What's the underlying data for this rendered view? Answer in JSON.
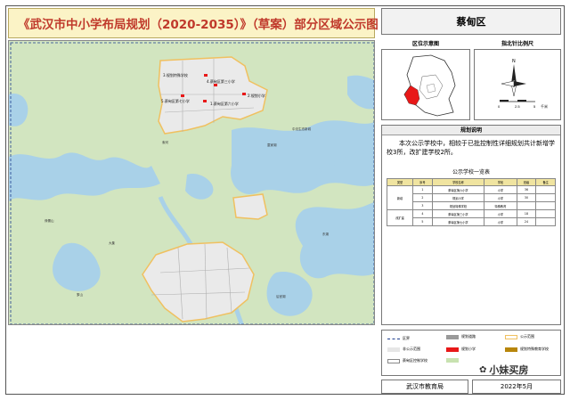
{
  "title": "《武汉市中小学布局规划（2020-2035）》（草案）部分区域公示图",
  "district": "蔡甸区",
  "location_header": "区位示意图",
  "north_header": "指北针比例尺",
  "scale": {
    "ticks": [
      "0",
      "2.5",
      "5"
    ],
    "unit": "千米",
    "north": "N"
  },
  "description": {
    "header": "规划说明",
    "text": "本次公示学校中，相较于已批控制性详细规划共计新增学校3所，改扩建学校2所。"
  },
  "table": {
    "title": "公示学校一览表",
    "headers": [
      "类型",
      "序号",
      "学校名称",
      "学段",
      "班级",
      "备注"
    ],
    "rows": [
      {
        "type": "新增",
        "no": "1",
        "name": "蔡甸区第六小学",
        "level": "小学",
        "classes": "36",
        "note": ""
      },
      {
        "type": "",
        "no": "2",
        "name": "规划小学",
        "level": "小学",
        "classes": "30",
        "note": ""
      },
      {
        "type": "",
        "no": "3",
        "name": "规划特殊学校",
        "level": "特殊教育",
        "classes": "",
        "note": ""
      },
      {
        "type": "改扩建",
        "no": "4",
        "name": "蔡甸区第三小学",
        "level": "小学",
        "classes": "18",
        "note": ""
      },
      {
        "type": "",
        "no": "5",
        "name": "蔡甸区第七小学",
        "level": "小学",
        "classes": "24",
        "note": ""
      }
    ]
  },
  "legend": [
    {
      "label": "区界",
      "color": "#1f3f8f",
      "style": "dash"
    },
    {
      "label": "规划道路",
      "color": "#9a9a9a",
      "style": "fill"
    },
    {
      "label": "公示范围",
      "color": "#f0c060",
      "style": "outline"
    },
    {
      "label": "非公示范围",
      "color": "#e6e6e6",
      "style": "fill"
    },
    {
      "label": "规划小学",
      "color": "#e81818",
      "style": "fill"
    },
    {
      "label": "规划特殊教育学校",
      "color": "#b8860b",
      "style": "fill"
    },
    {
      "label": "蔡甸区控制学校",
      "color": "#ffffff",
      "style": "outline"
    },
    {
      "label": "",
      "color": "#c8e2b0",
      "style": "fill"
    },
    {
      "label": "",
      "color": "#a8d0e8",
      "style": "fill"
    }
  ],
  "map": {
    "schools": [
      {
        "label": "3.规划特殊学校"
      },
      {
        "label": "4.蔡甸区第三小学"
      },
      {
        "label": "2.规划小学"
      },
      {
        "label": "5.蔡甸区第七小学"
      },
      {
        "label": "1.蔡甸区第六小学"
      }
    ],
    "places": [
      "中法生态新城",
      "索河",
      "大集",
      "奓山",
      "侏儒山",
      "东湖",
      "童家湖",
      "后官湖"
    ]
  },
  "footer": {
    "org": "武汉市教育局",
    "date": "2022年5月"
  },
  "watermark": "小妹买房",
  "colors": {
    "title_bg": "#fbf3c6",
    "title_text": "#c0392b",
    "water": "#a8d0e8",
    "green": "#c8e2b0",
    "urban": "#e9e9e9",
    "boundary": "#f0c060",
    "school": "#e81818"
  }
}
